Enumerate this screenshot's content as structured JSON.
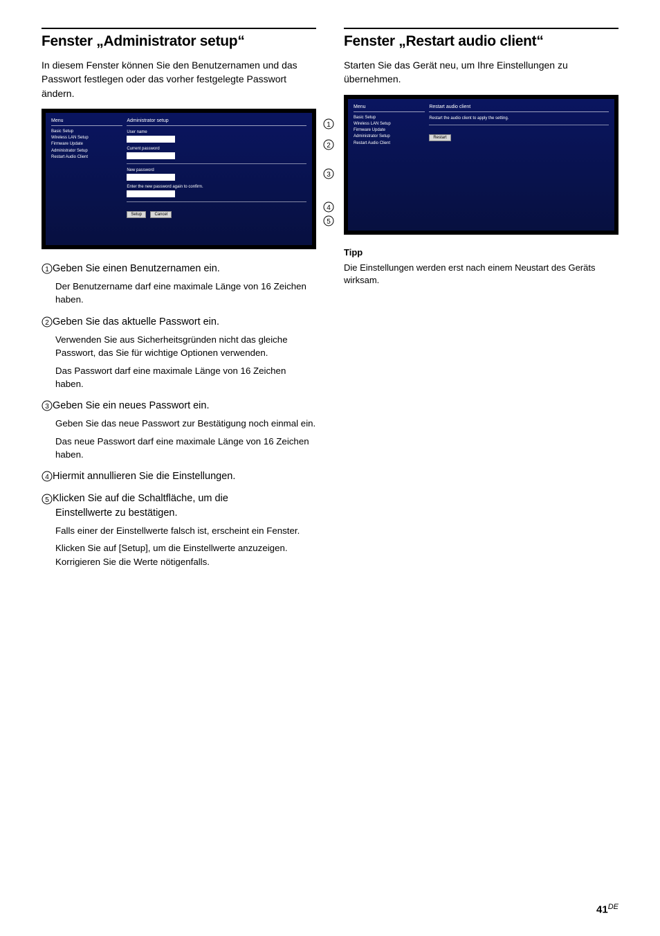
{
  "left": {
    "heading": "Fenster „Administrator setup“",
    "intro": "In diesem Fenster können Sie den Benutzernamen und das Passwort festlegen oder das vorher festgelegte Passwort ändern.",
    "shot": {
      "menu_header": "Menu",
      "content_header": "Administrator setup",
      "sidebar_items": [
        "Basic Setup",
        "Wireless LAN Setup",
        "Firmware Update",
        "Administrator Setup",
        "Restart Audio Client"
      ],
      "labels": {
        "user_name": "User name",
        "current_password": "Current password",
        "new_password": "New password",
        "confirm": "Enter the new password again to confirm."
      },
      "buttons": {
        "setup": "Setup",
        "cancel": "Cancel"
      }
    },
    "steps": [
      {
        "num": "1",
        "title": "Geben Sie einen Benutzernamen ein.",
        "paras": [
          "Der Benutzername darf eine maximale Länge von 16 Zeichen haben."
        ]
      },
      {
        "num": "2",
        "title": "Geben Sie das aktuelle Passwort ein.",
        "paras": [
          "Verwenden Sie aus Sicherheitsgründen nicht das gleiche Passwort, das Sie für wichtige Optionen verwenden.",
          "Das Passwort darf eine maximale Länge von 16 Zeichen haben."
        ]
      },
      {
        "num": "3",
        "title": "Geben Sie ein neues Passwort ein.",
        "paras": [
          "Geben Sie das neue Passwort zur Bestätigung noch einmal ein.",
          "Das neue Passwort darf eine maximale Länge von 16 Zeichen haben."
        ]
      },
      {
        "num": "4",
        "title": "Hiermit annullieren Sie die Einstellungen.",
        "paras": []
      },
      {
        "num": "5",
        "title": "Klicken Sie auf die Schaltfläche, um die Einstellwerte zu bestätigen.",
        "title2": "Einstellwerte zu bestätigen.",
        "paras": [
          "Falls einer der Einstellwerte falsch ist, erscheint ein Fenster.",
          "Klicken Sie auf [Setup], um die Einstellwerte anzuzeigen. Korrigieren Sie die Werte nötigenfalls."
        ]
      }
    ]
  },
  "right": {
    "heading": "Fenster „Restart audio client“",
    "intro": "Starten Sie das Gerät neu, um Ihre Einstellungen zu übernehmen.",
    "shot": {
      "menu_header": "Menu",
      "content_header": "Restart audio client",
      "sidebar_items": [
        "Basic Setup",
        "Wireless LAN Setup",
        "Firmware Update",
        "Administrator Setup",
        "Restart Audio Client"
      ],
      "instruction": "Restart the audio client to apply the setting.",
      "buttons": {
        "restart": "Restart"
      }
    },
    "tipp_heading": "Tipp",
    "tipp_body": "Die Einstellungen werden erst nach einem Neustart des Geräts wirksam."
  },
  "footer": {
    "page": "41",
    "lang": "DE"
  }
}
